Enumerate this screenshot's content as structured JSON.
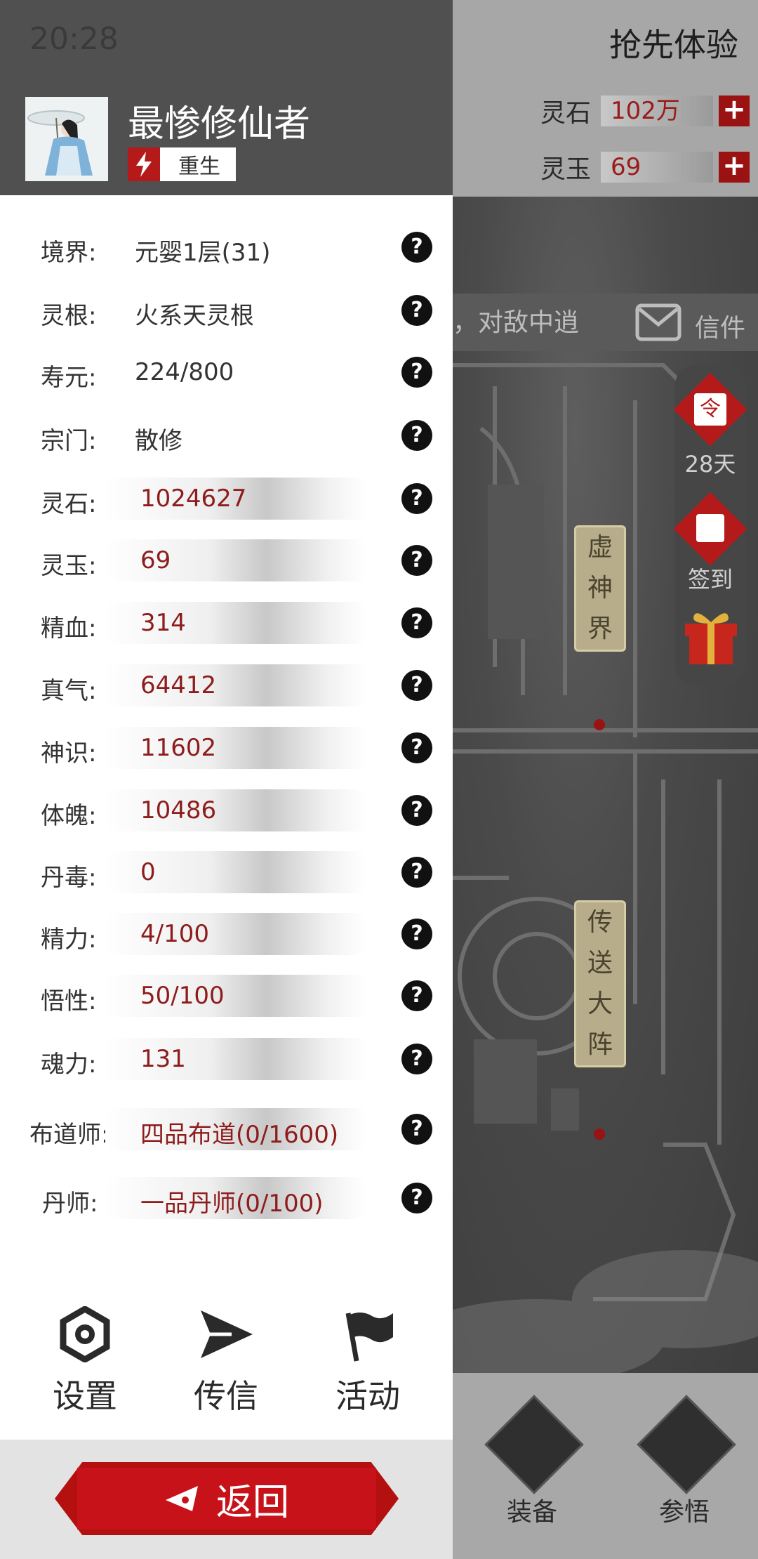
{
  "status_bar": {
    "time": "20:28"
  },
  "background": {
    "trial_title": "抢先体验",
    "resources": [
      {
        "label": "灵石",
        "value": "102万"
      },
      {
        "label": "灵玉",
        "value": "69"
      }
    ],
    "banner_text": "，对敌中逍",
    "mail_label": "信件",
    "side_buttons": [
      {
        "icon": "token-icon",
        "label": "28天"
      },
      {
        "icon": "signin-icon",
        "label": "签到"
      },
      {
        "icon": "gift-icon",
        "label": ""
      }
    ],
    "map_signs": [
      {
        "text": "虚神界"
      },
      {
        "text": "传送大阵"
      }
    ],
    "bottom_buttons": [
      {
        "icon": "sword-icon",
        "label": "装备"
      },
      {
        "icon": "lotus-icon",
        "label": "参悟"
      }
    ]
  },
  "profile": {
    "name": "最惨修仙者",
    "badge": "重生"
  },
  "stats": [
    {
      "label": "境界:",
      "value": "元婴1层(31)",
      "bar": false
    },
    {
      "label": "灵根:",
      "value": "火系天灵根",
      "bar": false
    },
    {
      "label": "寿元:",
      "value": "224/800",
      "bar": false
    },
    {
      "label": "宗门:",
      "value": "散修",
      "bar": false
    },
    {
      "label": "灵石:",
      "value": "1024627",
      "bar": true
    },
    {
      "label": "灵玉:",
      "value": "69",
      "bar": true
    },
    {
      "label": "精血:",
      "value": "314",
      "bar": true
    },
    {
      "label": "真气:",
      "value": "64412",
      "bar": true
    },
    {
      "label": "神识:",
      "value": "11602",
      "bar": true
    },
    {
      "label": "体魄:",
      "value": "10486",
      "bar": true
    },
    {
      "label": "丹毒:",
      "value": "0",
      "bar": true
    },
    {
      "label": "精力:",
      "value": "4/100",
      "bar": true
    },
    {
      "label": "悟性:",
      "value": "50/100",
      "bar": true
    },
    {
      "label": "魂力:",
      "value": "131",
      "bar": true
    },
    {
      "label": "布道师:",
      "value": "四品布道(0/1600)",
      "bar": true
    },
    {
      "label": "丹师:",
      "value": "一品丹师(0/100)",
      "bar": true
    }
  ],
  "help_glyph": "?",
  "menu": {
    "settings": "设置",
    "message": "传信",
    "activity": "活动"
  },
  "back_label": "返回"
}
